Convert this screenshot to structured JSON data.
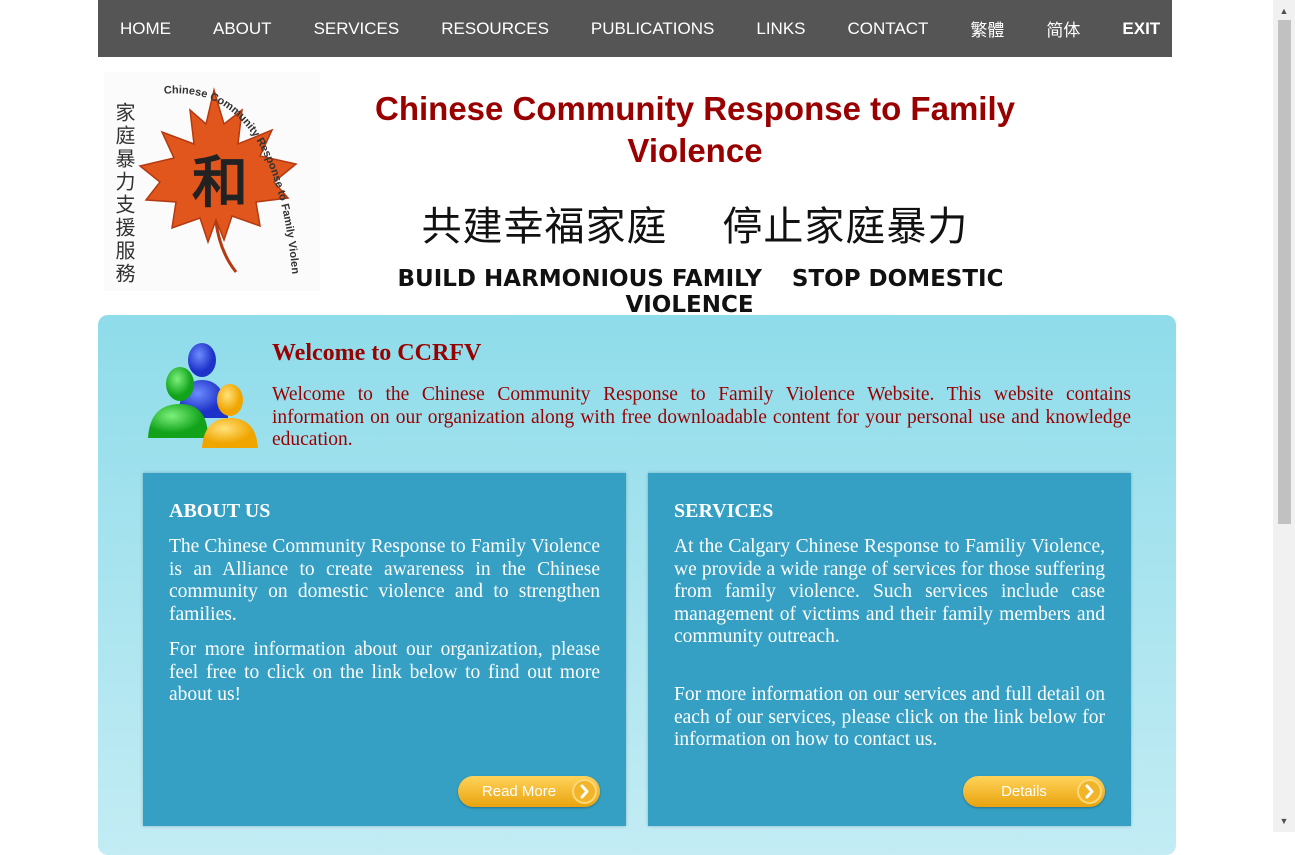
{
  "nav": {
    "items": [
      "HOME",
      "ABOUT",
      "SERVICES",
      "RESOURCES",
      "PUBLICATIONS",
      "LINKS",
      "CONTACT",
      "繁體",
      "简体"
    ],
    "exit": "EXIT"
  },
  "header": {
    "title": "Chinese Community Response to Family Violence",
    "slogan_cn_1": "共建幸福家庭",
    "slogan_cn_2": "停止家庭暴力",
    "slogan_en_1": "BUILD HARMONIOUS FAMILY",
    "slogan_en_2": "STOP DOMESTIC VIOLENCE",
    "logo": {
      "chinese_text": "家庭暴力支援服務",
      "center_char": "和",
      "arc_text": "Chinese Community Response to Family Violence",
      "colors": {
        "leaf": "#e0561c",
        "leaf_dark": "#b33a12"
      }
    }
  },
  "welcome": {
    "title": "Welcome to CCRFV",
    "text": "Welcome to the Chinese Community Response to Family Violence Website. This website contains information on our organization along with free downloadable content for your personal use and knowledge education.",
    "icon": "people-group-icon"
  },
  "about_card": {
    "title": "ABOUT US",
    "p1": "The Chinese Community Response to Family Violence is an Alliance to create awareness in the Chinese community on domestic violence and to strengthen families.",
    "p2": "For more information about our organization, please feel free to click on the link below to find out more about us!",
    "button": "Read More"
  },
  "services_card": {
    "title": "SERVICES",
    "p1": "At the Calgary Chinese Response to Familiy Violence, we provide a wide range of services for those suffering from family violence. Such services include case management of victims and their family members and community outreach.",
    "p2": "For more information on our services and full detail on each of our services, please click on the link below for information on how to contact us.",
    "button": "Details"
  },
  "colors": {
    "nav_bg": "#555555",
    "title_red": "#990000",
    "panel_light": "#8fdcea",
    "card_blue": "#35a0c3",
    "button_gold": "#e9a30e"
  }
}
